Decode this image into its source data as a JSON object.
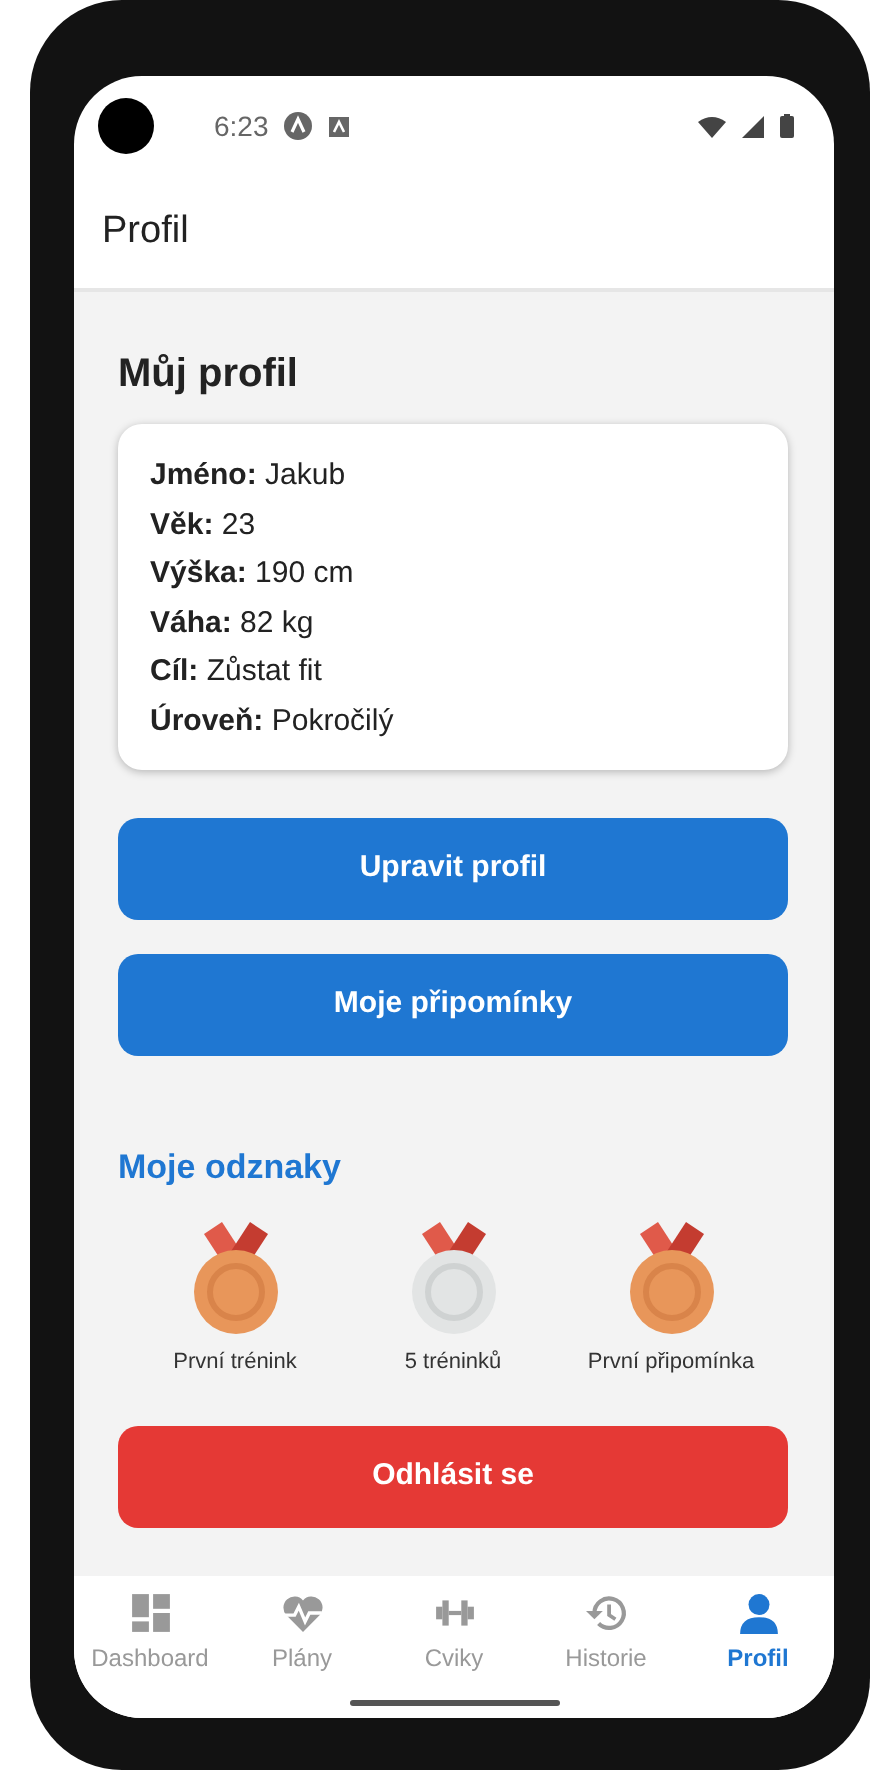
{
  "status_bar": {
    "time": "6:23"
  },
  "app_bar": {
    "title": "Profil"
  },
  "profile": {
    "heading": "Můj profil",
    "fields": [
      {
        "label": "Jméno:",
        "value": "Jakub"
      },
      {
        "label": "Věk:",
        "value": "23"
      },
      {
        "label": "Výška:",
        "value": "190 cm"
      },
      {
        "label": "Váha:",
        "value": "82 kg"
      },
      {
        "label": "Cíl:",
        "value": "Zůstat fit"
      },
      {
        "label": "Úroveň:",
        "value": "Pokročilý"
      }
    ]
  },
  "actions": [
    {
      "label": "Upravit profil",
      "kind": "primary"
    },
    {
      "label": "Moje připomínky",
      "kind": "primary"
    }
  ],
  "badges": {
    "heading": "Moje odznaky",
    "items": [
      {
        "label": "První trénink",
        "kind": "bronze"
      },
      {
        "label": "5 tréninků",
        "kind": "silver"
      },
      {
        "label": "První připomínka",
        "kind": "bronze"
      }
    ]
  },
  "logout": {
    "label": "Odhlásit se",
    "kind": "danger"
  },
  "tabs": [
    {
      "label": "Dashboard",
      "kind": "dashboard",
      "selected": false
    },
    {
      "label": "Plány",
      "kind": "heart",
      "selected": false
    },
    {
      "label": "Cviky",
      "kind": "dumbbell",
      "selected": false
    },
    {
      "label": "Historie",
      "kind": "history",
      "selected": false
    },
    {
      "label": "Profil",
      "kind": "person",
      "selected": true
    }
  ]
}
